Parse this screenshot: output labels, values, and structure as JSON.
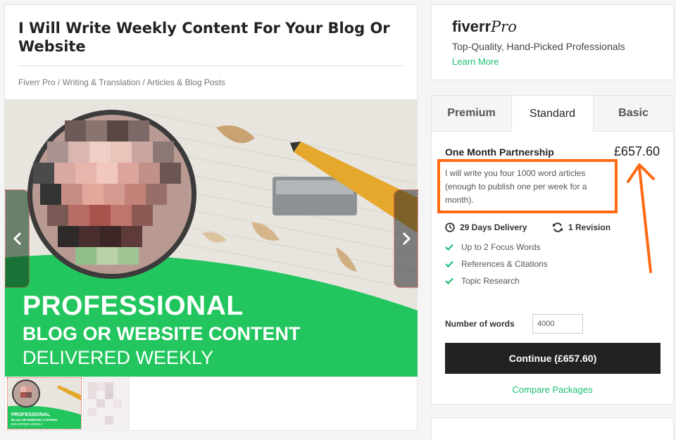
{
  "gig": {
    "title": "I Will Write Weekly Content For Your Blog Or Website",
    "breadcrumb": "Fiverr Pro / Writing & Translation / Articles & Blog Posts"
  },
  "hero": {
    "line1": "PROFESSIONAL",
    "line2": "BLOG OR WEBSITE CONTENT",
    "line3": "DELIVERED WEEKLY",
    "green": "#22c55e"
  },
  "thumbnail": {
    "line1": "PROFESSIONAL",
    "line2": "BLOG OR WEBSITE CONTENT",
    "line3": "DELIVERED WEEKLY"
  },
  "pro": {
    "logo_word": "fiverr",
    "logo_script": "Pro",
    "tagline": "Top-Quality, Hand-Picked Professionals",
    "link": "Learn More"
  },
  "package": {
    "tabs": [
      "Premium",
      "Standard",
      "Basic"
    ],
    "selected_tab": "Standard",
    "name": "One Month Partnership",
    "price": "£657.60",
    "description": "I will write you four 1000 word articles (enough to publish one per week for a month).",
    "delivery": "29 Days Delivery",
    "revisions": "1 Revision",
    "features": [
      "Up to 2 Focus Words",
      "References & Citations",
      "Topic Research"
    ],
    "words_label": "Number of words",
    "words_value": "4000",
    "continue_label": "Continue (£657.60)",
    "compare_label": "Compare Packages"
  },
  "colors": {
    "accent_green": "#1dbf73",
    "annotation_orange": "#ff6a13"
  }
}
